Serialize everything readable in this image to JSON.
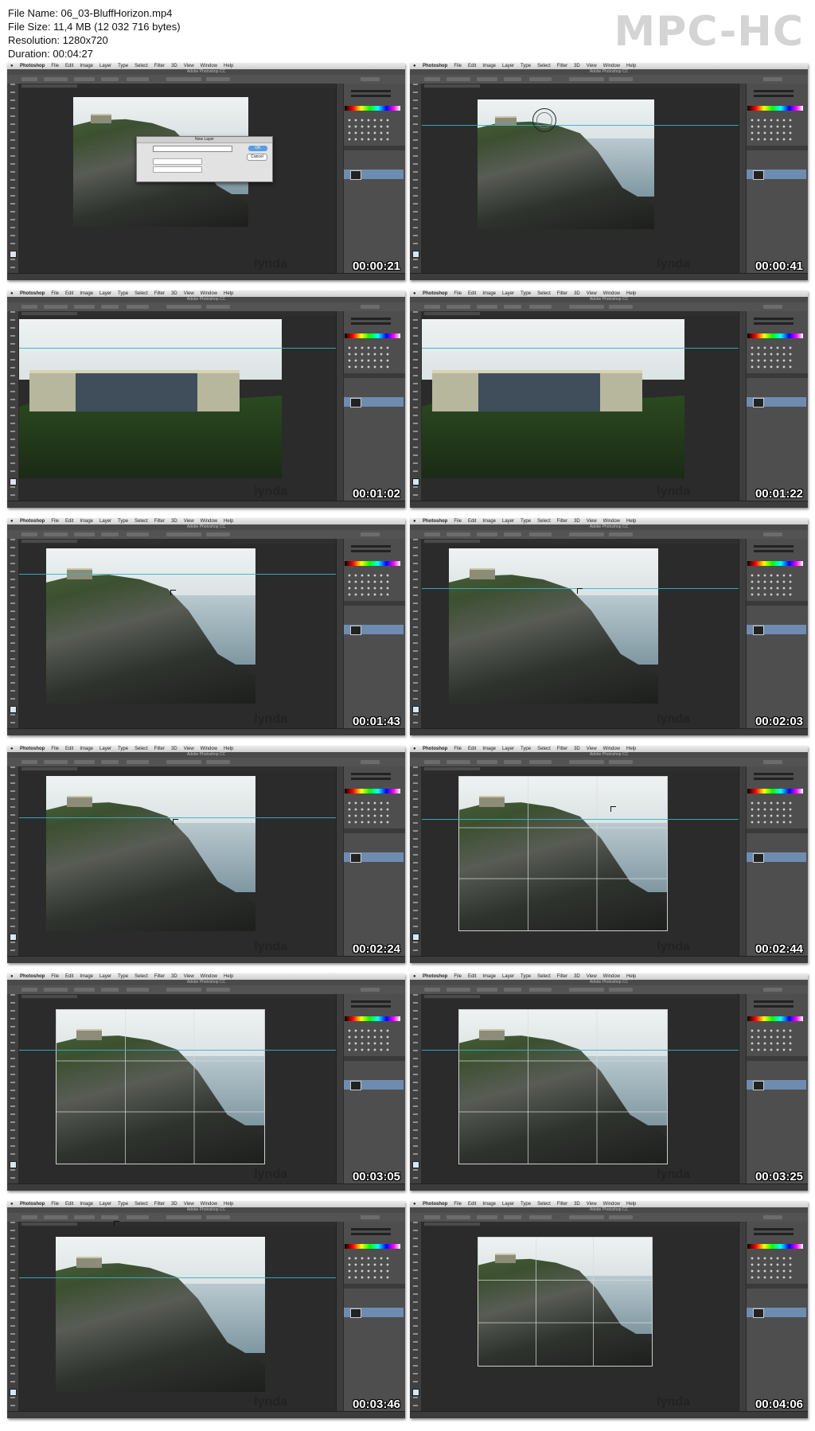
{
  "info": {
    "file_name": "File Name: 06_03-BluffHorizon.mp4",
    "file_size": "File Size: 11,4 MB (12 032 716 bytes)",
    "resolution": "Resolution: 1280x720",
    "duration": "Duration: 00:04:27"
  },
  "logo": "MPC-HC",
  "app": {
    "menu": [
      "Photoshop",
      "File",
      "Edit",
      "Image",
      "Layer",
      "Type",
      "Select",
      "Filter",
      "3D",
      "View",
      "Window",
      "Help"
    ],
    "window_title": "Adobe Photoshop CC"
  },
  "dialog": {
    "title": "New Layer",
    "ok": "OK",
    "cancel": "Cancel"
  },
  "watermark": "lynda",
  "frames": [
    {
      "time": "00:00:21"
    },
    {
      "time": "00:00:41"
    },
    {
      "time": "00:01:02"
    },
    {
      "time": "00:01:22"
    },
    {
      "time": "00:01:43"
    },
    {
      "time": "00:02:03"
    },
    {
      "time": "00:02:24"
    },
    {
      "time": "00:02:44"
    },
    {
      "time": "00:03:05"
    },
    {
      "time": "00:03:25"
    },
    {
      "time": "00:03:46"
    },
    {
      "time": "00:04:06"
    }
  ]
}
